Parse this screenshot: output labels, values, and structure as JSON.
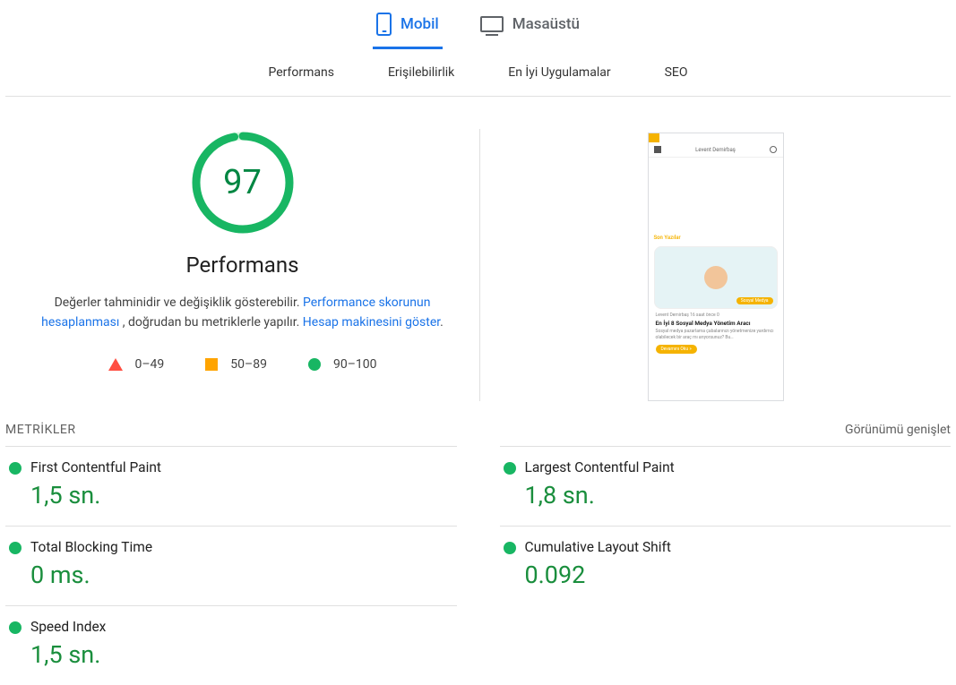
{
  "tabs": {
    "mobile": "Mobil",
    "desktop": "Masaüstü"
  },
  "categories": {
    "performance": "Performans",
    "accessibility": "Erişilebilirlik",
    "best_practices": "En İyi Uygulamalar",
    "seo": "SEO"
  },
  "gauge": {
    "score": "97",
    "title": "Performans"
  },
  "description": {
    "pre": "Değerler tahminidir ve değişiklik gösterebilir. ",
    "link1": "Performance skorunun hesaplanması",
    "mid": " , doğrudan bu metriklerle yapılır. ",
    "link2": "Hesap makinesini göster",
    "post": "."
  },
  "legend": {
    "bad": "0–49",
    "avg": "50–89",
    "good": "90–100"
  },
  "preview": {
    "brand": "Levent Demirbaş",
    "section": "Son Yazılar",
    "badge": "Sosyal Medya",
    "meta": "Levent Demirbaş  16 saat önce  0",
    "title": "En İyi 8 Sosyal Medya Yönetim Aracı",
    "body": "Sosyal medya pazarlama çabalarınızı yönetmenize yardımcı olabilecek bir araç mı arıyorsunuz? Bu…",
    "button": "Devamını Oku »"
  },
  "metrics_header": {
    "title": "METRİKLER",
    "expand": "Görünümü genişlet"
  },
  "metrics": {
    "fcp": {
      "name": "First Contentful Paint",
      "value": "1,5 sn."
    },
    "lcp": {
      "name": "Largest Contentful Paint",
      "value": "1,8 sn."
    },
    "tbt": {
      "name": "Total Blocking Time",
      "value": "0 ms."
    },
    "cls": {
      "name": "Cumulative Layout Shift",
      "value": "0.092"
    },
    "si": {
      "name": "Speed Index",
      "value": "1,5 sn."
    }
  }
}
